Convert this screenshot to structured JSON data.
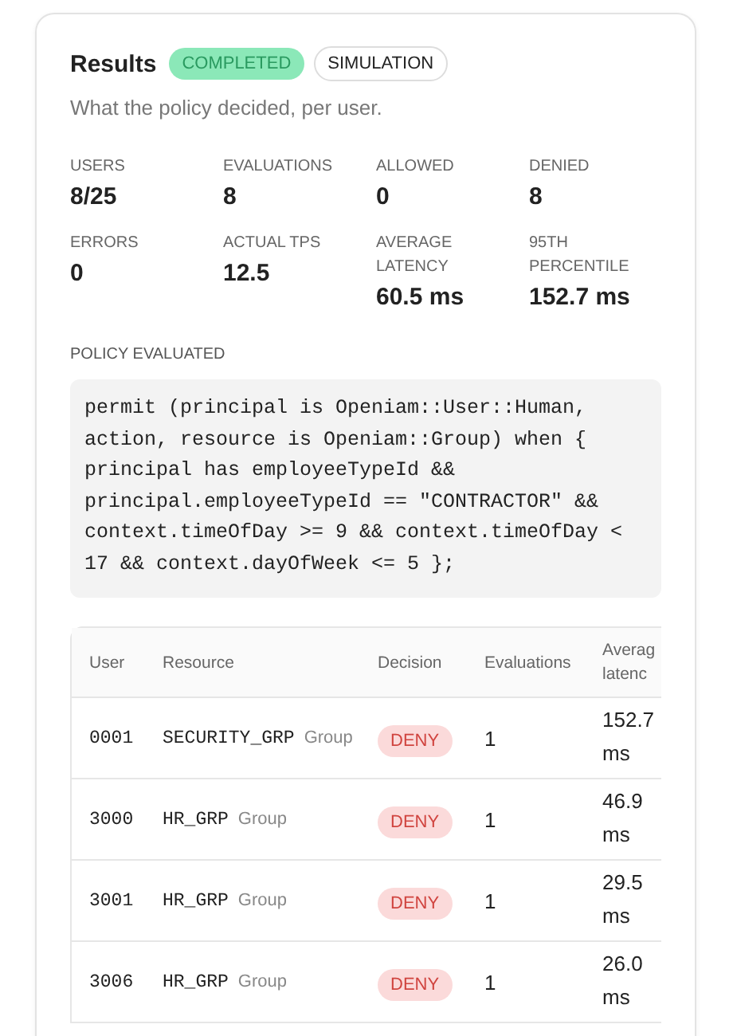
{
  "title": "Results",
  "badges": [
    {
      "label": "COMPLETED",
      "kind": "success"
    },
    {
      "label": "SIMULATION",
      "kind": "neutral"
    }
  ],
  "subtitle": "What the policy decided, per user.",
  "stats": [
    {
      "label": "USERS",
      "value": "8/25"
    },
    {
      "label": "EVALUATIONS",
      "value": "8"
    },
    {
      "label": "ALLOWED",
      "value": "0"
    },
    {
      "label": "DENIED",
      "value": "8"
    },
    {
      "label": "ERRORS",
      "value": "0"
    },
    {
      "label": "ACTUAL TPS",
      "value": "12.5"
    },
    {
      "label": "AVERAGE LATENCY",
      "value": "60.5 ms"
    },
    {
      "label": "95TH PERCENTILE",
      "value": "152.7 ms"
    }
  ],
  "policy_label": "POLICY EVALUATED",
  "policy": "permit (principal is Openiam::User::Human,\naction, resource is Openiam::Group) when {\nprincipal has employeeTypeId &&\nprincipal.employeeTypeId == \"CONTRACTOR\" &&\ncontext.timeOfDay >= 9 && context.timeOfDay <\n17 && context.dayOfWeek <= 5 };",
  "table": {
    "columns": [
      "User",
      "Resource",
      "Decision",
      "Evaluations",
      "Averag latenc"
    ],
    "rows": [
      {
        "user": "0001",
        "resource": "SECURITY_GRP",
        "resource_type": "Group",
        "decision": "DENY",
        "kind": "deny",
        "evaluations": "1",
        "latency": "152.7 ms"
      },
      {
        "user": "3000",
        "resource": "HR_GRP",
        "resource_type": "Group",
        "decision": "DENY",
        "kind": "deny",
        "evaluations": "1",
        "latency": "46.9 ms"
      },
      {
        "user": "3001",
        "resource": "HR_GRP",
        "resource_type": "Group",
        "decision": "DENY",
        "kind": "deny",
        "evaluations": "1",
        "latency": "29.5 ms"
      },
      {
        "user": "3006",
        "resource": "HR_GRP",
        "resource_type": "Group",
        "decision": "DENY",
        "kind": "deny",
        "evaluations": "1",
        "latency": "26.0 ms"
      }
    ]
  }
}
